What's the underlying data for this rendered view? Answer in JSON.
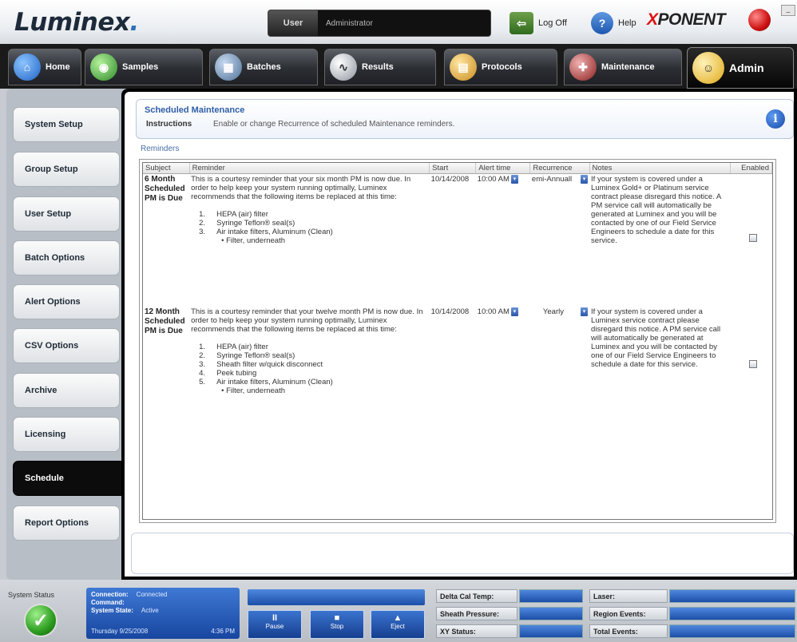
{
  "header": {
    "logo": "Luminex",
    "user_label": "User",
    "user_value": "Administrator",
    "logoff_label": "Log Off",
    "help_label": "Help",
    "brand": "PONENT",
    "brand_prefix": "X"
  },
  "nav": {
    "tabs": [
      {
        "label": "Home",
        "icon": "home-icon",
        "color": "#3a8be0"
      },
      {
        "label": "Samples",
        "icon": "samples-icon",
        "color": "#4ab04a"
      },
      {
        "label": "Batches",
        "icon": "batches-icon",
        "color": "#6c8fb8"
      },
      {
        "label": "Results",
        "icon": "results-icon",
        "color": "#c9cfd6"
      },
      {
        "label": "Protocols",
        "icon": "protocols-icon",
        "color": "#e3b53a"
      },
      {
        "label": "Maintenance",
        "icon": "maintenance-icon",
        "color": "#b64040"
      },
      {
        "label": "Admin",
        "icon": "admin-icon",
        "color": "#f2c84b"
      }
    ]
  },
  "sidebar": {
    "items": [
      {
        "label": "System Setup"
      },
      {
        "label": "Group Setup"
      },
      {
        "label": "User Setup"
      },
      {
        "label": "Batch Options"
      },
      {
        "label": "Alert Options"
      },
      {
        "label": "CSV Options"
      },
      {
        "label": "Archive"
      },
      {
        "label": "Licensing"
      },
      {
        "label": "Schedule"
      },
      {
        "label": "Report Options"
      }
    ],
    "active_index": 8
  },
  "main": {
    "title": "Scheduled Maintenance",
    "instructions_label": "Instructions",
    "instructions_text": "Enable or change Recurrence of scheduled Maintenance reminders.",
    "reminders_label": "Reminders",
    "table": {
      "headers": [
        "Subject",
        "Reminder",
        "Start",
        "Alert time",
        "Recurrence",
        "Notes",
        "Enabled"
      ],
      "rows": [
        {
          "subject": "6 Month Scheduled PM is Due",
          "reminder_intro": "This is a courtesy reminder that your six month PM is now due. In order to help keep your system running optimally, Luminex recommends that the following items be replaced at this time:",
          "items": [
            "HEPA (air) filter",
            "Syringe Teflon® seal(s)",
            "Air intake filters, Aluminum (Clean)"
          ],
          "sub_item": "• Filter, underneath",
          "start": "10/14/2008",
          "alert_time": "10:00 AM",
          "recurrence": "emi-Annuall",
          "notes": "If your system is covered under a Luminex Gold+ or Platinum service contract please disregard this notice. A PM service call will automatically be generated at Luminex and you will be contacted by one of our Field Service Engineers to schedule a date for this service."
        },
        {
          "subject": "12 Month Scheduled PM is Due",
          "reminder_intro": "This is a courtesy reminder that your twelve month PM is now due. In order to help keep your system running optimally, Luminex recommends that the following items be replaced at this time:",
          "items": [
            "HEPA (air) filter",
            "Syringe Teflon® seal(s)",
            "Sheath filter w/quick disconnect",
            "Peek tubing",
            "Air intake filters, Aluminum (Clean)"
          ],
          "sub_item": "• Filter, underneath",
          "start": "10/14/2008",
          "alert_time": "10:00 AM",
          "recurrence": "Yearly",
          "notes": "If your system is covered under a Luminex service contract please disregard this notice. A PM service call will automatically be generated at Luminex and you will be contacted by one of our Field Service Engineers to schedule a date for this service."
        }
      ]
    }
  },
  "status": {
    "label": "System Status",
    "connection_label": "Connection:",
    "connection_value": "Connected",
    "command_label": "Command:",
    "system_state_label": "System State:",
    "system_state_value": "Active",
    "date": "Thursday 9/25/2008",
    "time": "4:36 PM",
    "buttons": [
      "Pause",
      "Stop",
      "Eject"
    ],
    "labels": [
      "Delta Cal Temp:",
      "Sheath Pressure:",
      "XY Status:",
      "Laser:",
      "Region Events:",
      "Total Events:"
    ]
  }
}
